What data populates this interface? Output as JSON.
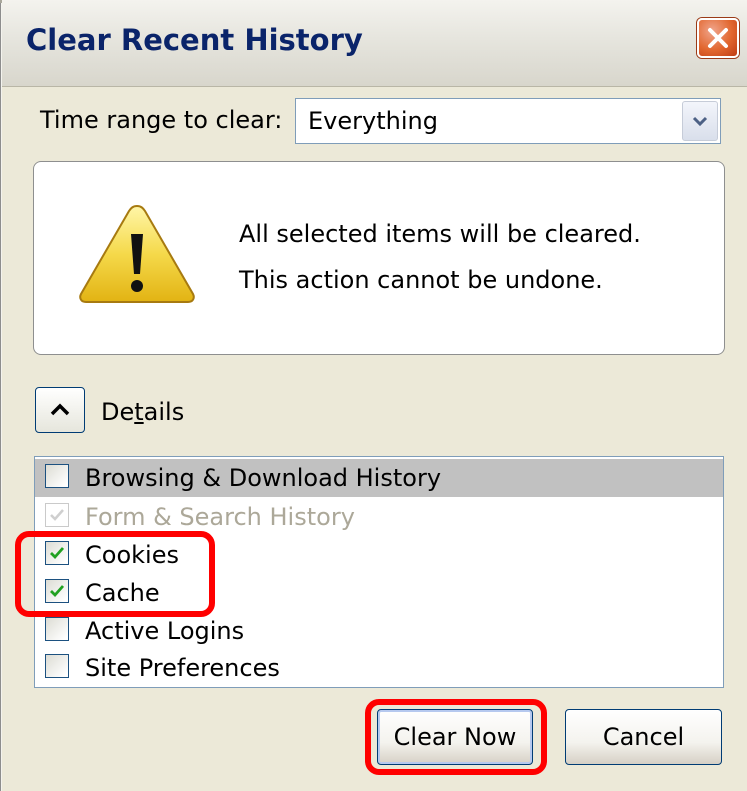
{
  "window": {
    "title": "Clear Recent History"
  },
  "time_range": {
    "label": "Time range to clear:",
    "selected": "Everything"
  },
  "warning": {
    "line1": "All selected items will be cleared.",
    "line2": "This action cannot be undone."
  },
  "details": {
    "label_prefix": "De",
    "label_accel": "t",
    "label_suffix": "ails",
    "expanded": true
  },
  "items": [
    {
      "label": "Browsing & Download History",
      "checked": false,
      "enabled": true,
      "selected": true
    },
    {
      "label": "Form & Search History",
      "checked": true,
      "enabled": false,
      "selected": false
    },
    {
      "label": "Cookies",
      "checked": true,
      "enabled": true,
      "selected": false
    },
    {
      "label": "Cache",
      "checked": true,
      "enabled": true,
      "selected": false
    },
    {
      "label": "Active Logins",
      "checked": false,
      "enabled": true,
      "selected": false
    },
    {
      "label": "Site Preferences",
      "checked": false,
      "enabled": true,
      "selected": false
    }
  ],
  "buttons": {
    "clear_now": "Clear Now",
    "cancel": "Cancel"
  },
  "colors": {
    "title": "#0a246a",
    "annotation": "#ff0000",
    "checkmark": "#21a121",
    "selection": "#c1c1c1"
  }
}
